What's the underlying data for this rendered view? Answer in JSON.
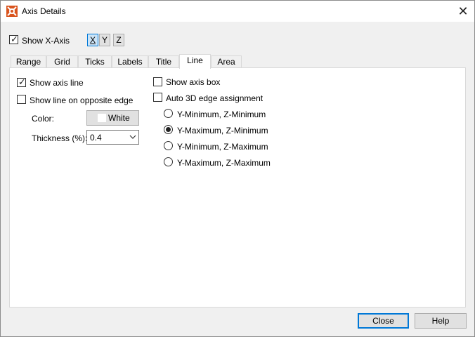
{
  "window": {
    "title": "Axis Details",
    "close_glyph": "✕",
    "app_icon": "tecplot-app-icon"
  },
  "top_row": {
    "show_axis": {
      "label": "Show X-Axis",
      "checked": true
    },
    "axis_buttons": [
      {
        "label": "X",
        "active": true
      },
      {
        "label": "Y",
        "active": false
      },
      {
        "label": "Z",
        "active": false
      }
    ]
  },
  "tabs": [
    {
      "label": "Range",
      "active": false
    },
    {
      "label": "Grid",
      "active": false
    },
    {
      "label": "Ticks",
      "active": false
    },
    {
      "label": "Labels",
      "active": false
    },
    {
      "label": "Title",
      "active": false
    },
    {
      "label": "Line",
      "active": true
    },
    {
      "label": "Area",
      "active": false
    }
  ],
  "line_tab": {
    "show_axis_line": {
      "label": "Show axis line",
      "checked": true
    },
    "show_opposite": {
      "label": "Show line on opposite edge",
      "checked": false
    },
    "color": {
      "label": "Color:",
      "value": "White",
      "swatch": "#ffffff"
    },
    "thickness": {
      "label": "Thickness (%):",
      "value": "0.4"
    },
    "show_axis_box": {
      "label": "Show axis box",
      "checked": false
    },
    "auto_3d": {
      "label": "Auto 3D edge assignment",
      "checked": false
    },
    "edge_options": [
      {
        "label": "Y-Minimum, Z-Minimum",
        "selected": false
      },
      {
        "label": "Y-Maximum, Z-Minimum",
        "selected": true
      },
      {
        "label": "Y-Minimum, Z-Maximum",
        "selected": false
      },
      {
        "label": "Y-Maximum, Z-Maximum",
        "selected": false
      }
    ]
  },
  "footer": {
    "close_label": "Close",
    "help_label": "Help"
  },
  "colors": {
    "accent": "#0078d7",
    "dialog_bg": "#f0f0f0",
    "panel_bg": "#ffffff"
  }
}
